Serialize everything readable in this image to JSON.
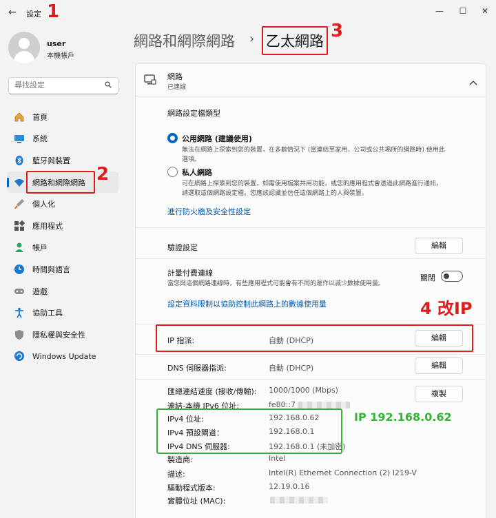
{
  "window": {
    "title": "設定",
    "minimize": "—",
    "maximize": "☐",
    "close": "✕",
    "back": "←"
  },
  "annotations": {
    "a1": "1",
    "a2": "2",
    "a3": "3",
    "a4": "4 改IP",
    "ip_note": "IP 192.168.0.62"
  },
  "user": {
    "name": "user",
    "account": "本機帳戶"
  },
  "search": {
    "placeholder": "尋找設定"
  },
  "sidebar": {
    "items": [
      {
        "label": "首頁",
        "icon": "home-icon"
      },
      {
        "label": "系統",
        "icon": "monitor-icon"
      },
      {
        "label": "藍牙與裝置",
        "icon": "bluetooth-icon"
      },
      {
        "label": "網路和網際網路",
        "icon": "wifi-icon"
      },
      {
        "label": "個人化",
        "icon": "brush-icon"
      },
      {
        "label": "應用程式",
        "icon": "apps-icon"
      },
      {
        "label": "帳戶",
        "icon": "person-icon"
      },
      {
        "label": "時間與語言",
        "icon": "clock-globe-icon"
      },
      {
        "label": "遊戲",
        "icon": "gamepad-icon"
      },
      {
        "label": "協助工具",
        "icon": "accessibility-icon"
      },
      {
        "label": "隱私權與安全性",
        "icon": "shield-icon"
      },
      {
        "label": "Windows Update",
        "icon": "update-icon"
      }
    ]
  },
  "breadcrumb": {
    "parent": "網路和網際網路",
    "separator": "›",
    "current": "乙太網路"
  },
  "network_card": {
    "title": "網路",
    "status": "已連線",
    "profile_heading": "網路設定檔類型",
    "public_label": "公用網路 (建議使用)",
    "public_desc_1": "無法在網路上探索到您的裝置，在多數情況下 (當連結至家用、公司或公共場所的網路時) 使用此",
    "public_desc_2": "選項。",
    "private_label": "私人網路",
    "private_desc_1": "可在網路上探索到您的裝置，如需使用檔案共用功能，或您的應用程式會透過此網路進行通訊，",
    "private_desc_2": "請選取這個網路設定檔。您應該認識並信任這個網路上的人與裝置。",
    "firewall_link": "進行防火牆及安全性設定",
    "auth_label": "驗證設定",
    "edit": "編輯",
    "metered_label": "計量付費連線",
    "metered_desc": "當您與這個網路連線時，有些應用程式可能會有不同的運作以減少數據使用量。",
    "metered_state": "關閉",
    "data_limit_link": "設定資料限制以協助控制此網路上的數據使用量",
    "ip_assign_label": "IP 指派:",
    "ip_assign_value": "自動 (DHCP)",
    "dns_assign_label": "DNS 伺服器指派:",
    "dns_assign_value": "自動 (DHCP)",
    "copy": "複製"
  },
  "details": {
    "speed_label": "匯總連結速度 (接收/傳輸):",
    "speed_value": "1000/1000 (Mbps)",
    "ipv6_label": "連結-本機 IPv6 位址:",
    "ipv6_value": "fe80::7",
    "ipv4_label": "IPv4 位址:",
    "ipv4_value": "192.168.0.62",
    "gateway_label": "IPv4 預設閘道：",
    "gateway_value": "192.168.0.1",
    "dns_label": "IPv4 DNS 伺服器:",
    "dns_value": "192.168.0.1 (未加密)",
    "maker_label": "製造商:",
    "maker_value": "Intel",
    "desc_label": "描述:",
    "desc_value": "Intel(R) Ethernet Connection (2) I219-V",
    "driver_label": "驅動程式版本:",
    "driver_value": "12.19.0.16",
    "mac_label": "實體位址 (MAC):"
  },
  "colors": {
    "accent": "#0067c0",
    "annotation_red": "#e01b1b",
    "annotation_green": "#32b532"
  }
}
